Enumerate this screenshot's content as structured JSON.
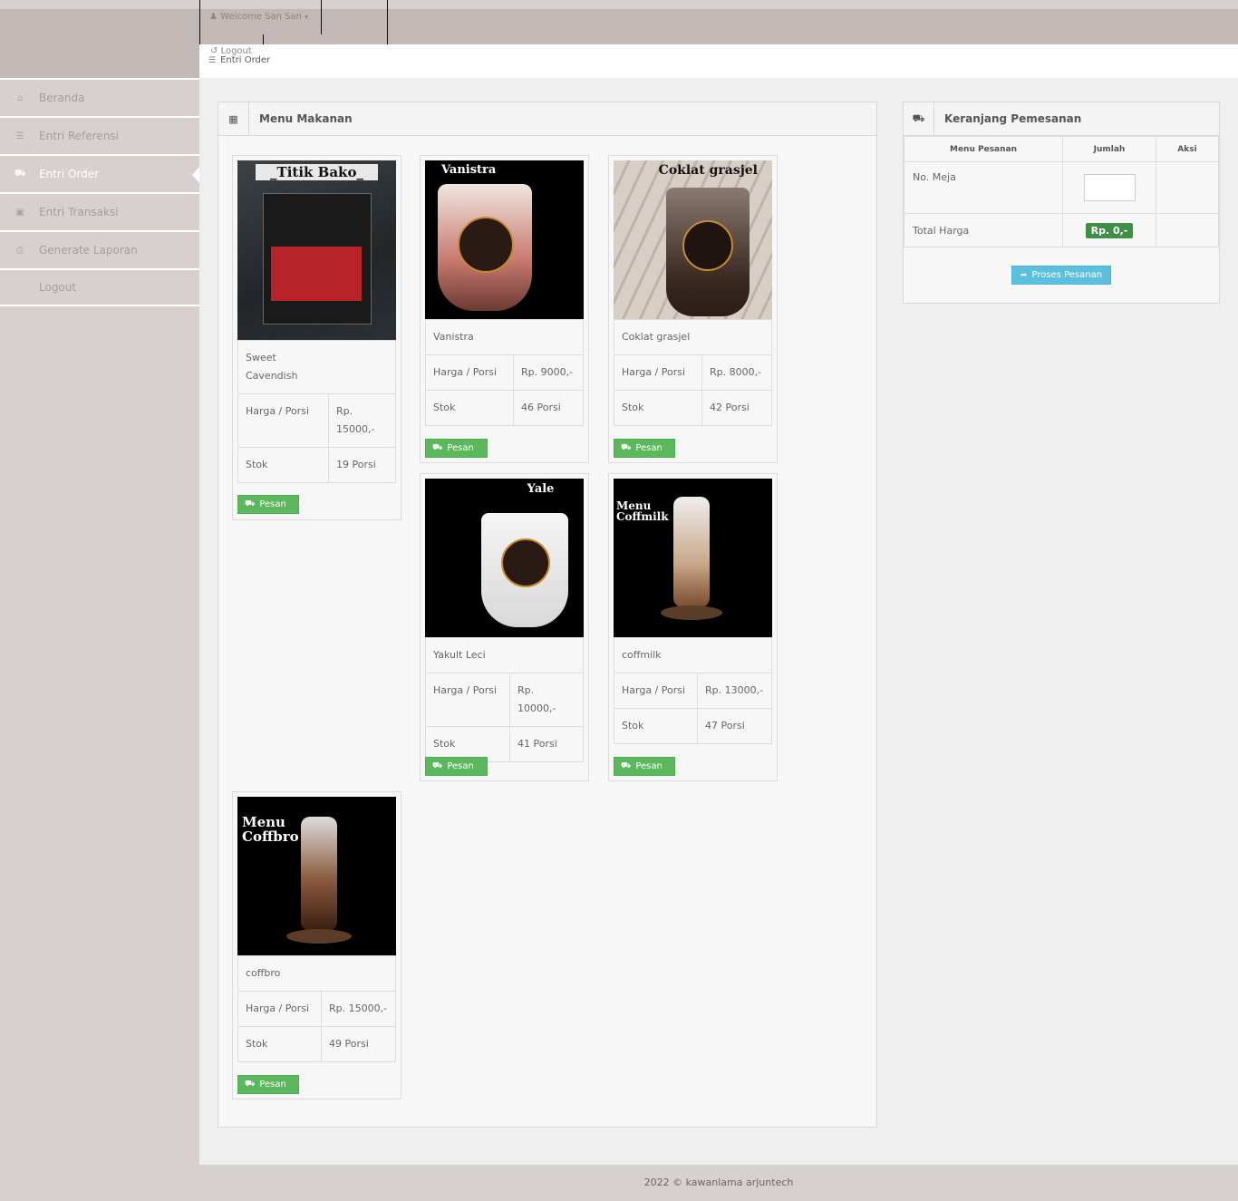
{
  "header": {
    "welcome": "Welcome San San",
    "logout": "Logout",
    "breadcrumb": "Entri Order"
  },
  "sidebar": {
    "items": [
      {
        "label": "Beranda",
        "icon": "home-icon"
      },
      {
        "label": "Entri Referensi",
        "icon": "list-icon"
      },
      {
        "label": "Entri Order",
        "icon": "cart-icon"
      },
      {
        "label": "Entri Transaksi",
        "icon": "laptop-icon"
      },
      {
        "label": "Generate Laporan",
        "icon": "print-icon"
      },
      {
        "label": "Logout",
        "icon": ""
      }
    ]
  },
  "menu_panel": {
    "title": "Menu Makanan",
    "price_label": "Harga / Porsi",
    "stock_label": "Stok",
    "order_button": "Pesan",
    "items": [
      {
        "name": "Sweet Cavendish",
        "price": "Rp. 15000,-",
        "stock": "19 Porsi",
        "photo_text": "_Titik Bako_"
      },
      {
        "name": "Vanistra",
        "price": "Rp. 9000,-",
        "stock": "46 Porsi",
        "photo_text": "Vanistra"
      },
      {
        "name": "Coklat grasjel",
        "price": "Rp. 8000,-",
        "stock": "42 Porsi",
        "photo_text": "Coklat grasjel"
      },
      {
        "name": "Yakult Leci",
        "price": "Rp. 10000,-",
        "stock": "41 Porsi",
        "photo_text": "Yale"
      },
      {
        "name": "coffmilk",
        "price": "Rp. 13000,-",
        "stock": "47 Porsi",
        "photo_text": "Menu Coffmilk"
      },
      {
        "name": "coffbro",
        "price": "Rp. 15000,-",
        "stock": "49 Porsi",
        "photo_text": "Menu Coffbro"
      }
    ]
  },
  "cart_panel": {
    "title": "Keranjang Pemesanan",
    "columns": [
      "Menu Pesanan",
      "Jumlah",
      "Aksi"
    ],
    "table_label": "No. Meja",
    "table_value": "",
    "total_label": "Total Harga",
    "total_value": "Rp. 0,-",
    "process_button": "Proses Pesanan"
  },
  "footer": "2022 © kawanlama arjuntech"
}
